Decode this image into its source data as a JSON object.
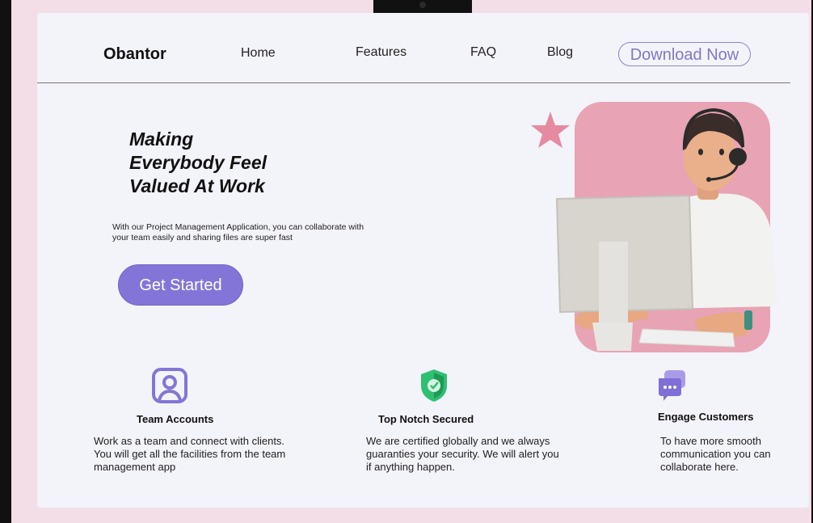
{
  "brand": {
    "name": "Obantor"
  },
  "nav": {
    "home": "Home",
    "features": "Features",
    "faq": "FAQ",
    "blog": "Blog",
    "download": "Download Now"
  },
  "hero": {
    "title_line1": "Making",
    "title_line2": "Everybody Feel",
    "title_line3": "Valued At Work",
    "subtitle_line1": "With our Project Management Application, you can collaborate with",
    "subtitle_line2": "your team easily and sharing files are super fast",
    "cta": "Get Started"
  },
  "features": [
    {
      "icon": "user-square-icon",
      "title": "Team Accounts",
      "line1": "Work as a team and connect with clients.",
      "line2": "You will get all the facilities from the team",
      "line3": "management app"
    },
    {
      "icon": "shield-check-icon",
      "title": "Top Notch Secured",
      "line1": "We are certified globally and we always",
      "line2": "guaranties your security. We will alert you",
      "line3": "if anything happen."
    },
    {
      "icon": "chat-bubbles-icon",
      "title": "Engage Customers",
      "line1": "To have more smooth",
      "line2": "communication you can",
      "line3": "collaborate here."
    }
  ],
  "colors": {
    "accent": "#8375d8",
    "pink": "#e8a3b4",
    "shield": "#2fbf71",
    "background": "#f3f3fa"
  }
}
